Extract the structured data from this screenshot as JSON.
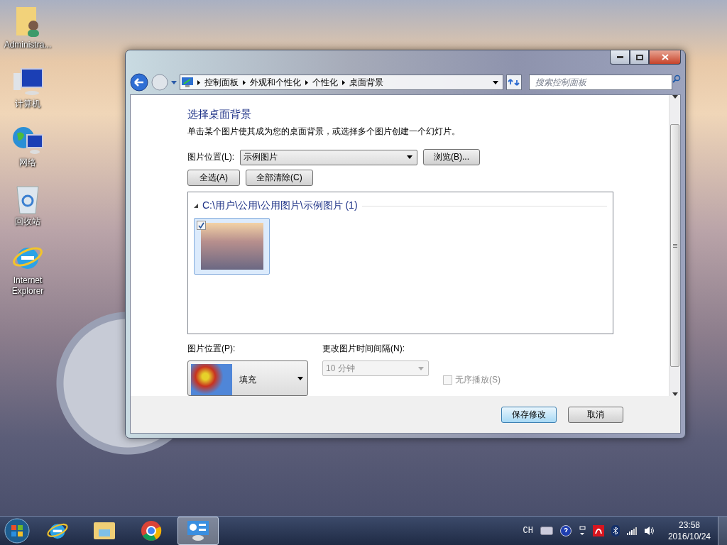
{
  "desktop_icons": [
    {
      "kind": "user-folder",
      "label": "Administra..."
    },
    {
      "kind": "computer",
      "label": "计算机"
    },
    {
      "kind": "network",
      "label": "网络"
    },
    {
      "kind": "recycle-bin",
      "label": "回收站"
    },
    {
      "kind": "browser",
      "label": "Internet Explorer"
    }
  ],
  "window": {
    "breadcrumb": [
      "控制面板",
      "外观和个性化",
      "个性化",
      "桌面背景"
    ],
    "search": {
      "placeholder": "搜索控制面板"
    },
    "heading": "选择桌面背景",
    "description": "单击某个图片使其成为您的桌面背景，或选择多个图片创建一个幻灯片。",
    "location_label": "图片位置(L):",
    "location_value": "示例图片",
    "browse_button": "浏览(B)...",
    "select_all_button": "全选(A)",
    "clear_all_button": "全部清除(C)",
    "group_title": "C:\\用户\\公用\\公用图片\\示例图片 (1)",
    "pictures": [
      {
        "checked": true,
        "selected": true
      }
    ],
    "position_label": "图片位置(P):",
    "position_value": "填充",
    "interval_label": "更改图片时间间隔(N):",
    "interval_value": "10 分钟",
    "interval_disabled": true,
    "shuffle": {
      "label": "无序播放(S)",
      "checked": false,
      "disabled": true
    },
    "buttons": [
      {
        "label": "保存修改",
        "default": true
      },
      {
        "label": "取消",
        "default": false
      }
    ]
  },
  "taskbar": {
    "apps": [
      {
        "kind": "browser",
        "active": false
      },
      {
        "kind": "folder",
        "active": false
      },
      {
        "kind": "chrome",
        "active": false
      },
      {
        "kind": "control-panel",
        "active": true
      }
    ],
    "language": "CH",
    "time": "23:58",
    "date": "2016/10/24"
  }
}
